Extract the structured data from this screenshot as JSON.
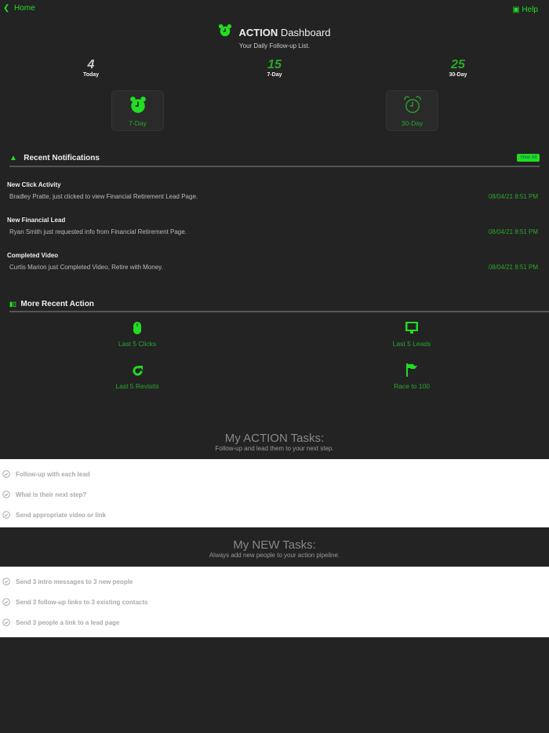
{
  "nav": {
    "back_label": "Home",
    "help_label": "Help"
  },
  "header": {
    "title_bold": "ACTION",
    "title_rest": " Dashboard",
    "subtitle": "Your Daily Follow-up List."
  },
  "stats": [
    {
      "value": "4",
      "label": "Today"
    },
    {
      "value": "15",
      "label": "7-Day"
    },
    {
      "value": "25",
      "label": "30-Day"
    }
  ],
  "cards": [
    {
      "label": "7-Day"
    },
    {
      "label": "30-Day"
    }
  ],
  "notifications": {
    "heading": "Recent Notifications",
    "view_all": "View All",
    "items": [
      {
        "title": "New Click Activity",
        "text": "Bradley Pratte, just clicked to view Financial Retirement Lead Page.",
        "date": "08/04/21 8:51 PM"
      },
      {
        "title": "New Financial Lead",
        "text": "Ryan Smith just requested info from Financial Retirement Page.",
        "date": "08/04/21 8:51 PM"
      },
      {
        "title": "Completed Video",
        "text": "Curtis Marion just Completed Video, Retire with Money.",
        "date": "08/04/21 8:51 PM"
      }
    ]
  },
  "more": {
    "heading": "More Recent Action",
    "items": [
      {
        "label": "Last 5 Clicks"
      },
      {
        "label": "Last 5 Leads"
      },
      {
        "label": "Last 5 Revisits"
      },
      {
        "label": "Race to 100"
      }
    ]
  },
  "action_tasks": {
    "heading": "My ACTION Tasks:",
    "sub": "Follow-up and lead them to your next step.",
    "items": [
      "Follow-up with each lead",
      "What is their next step?",
      "Send appropriate video or link"
    ]
  },
  "new_tasks": {
    "heading": "My NEW Tasks:",
    "sub": "Always add new people to your action pipeline.",
    "items": [
      "Send 3 intro messages to 3 new people",
      "Send 3 follow-up links to 3 existing contacts",
      "Send 3 people a link to a lead page"
    ]
  }
}
